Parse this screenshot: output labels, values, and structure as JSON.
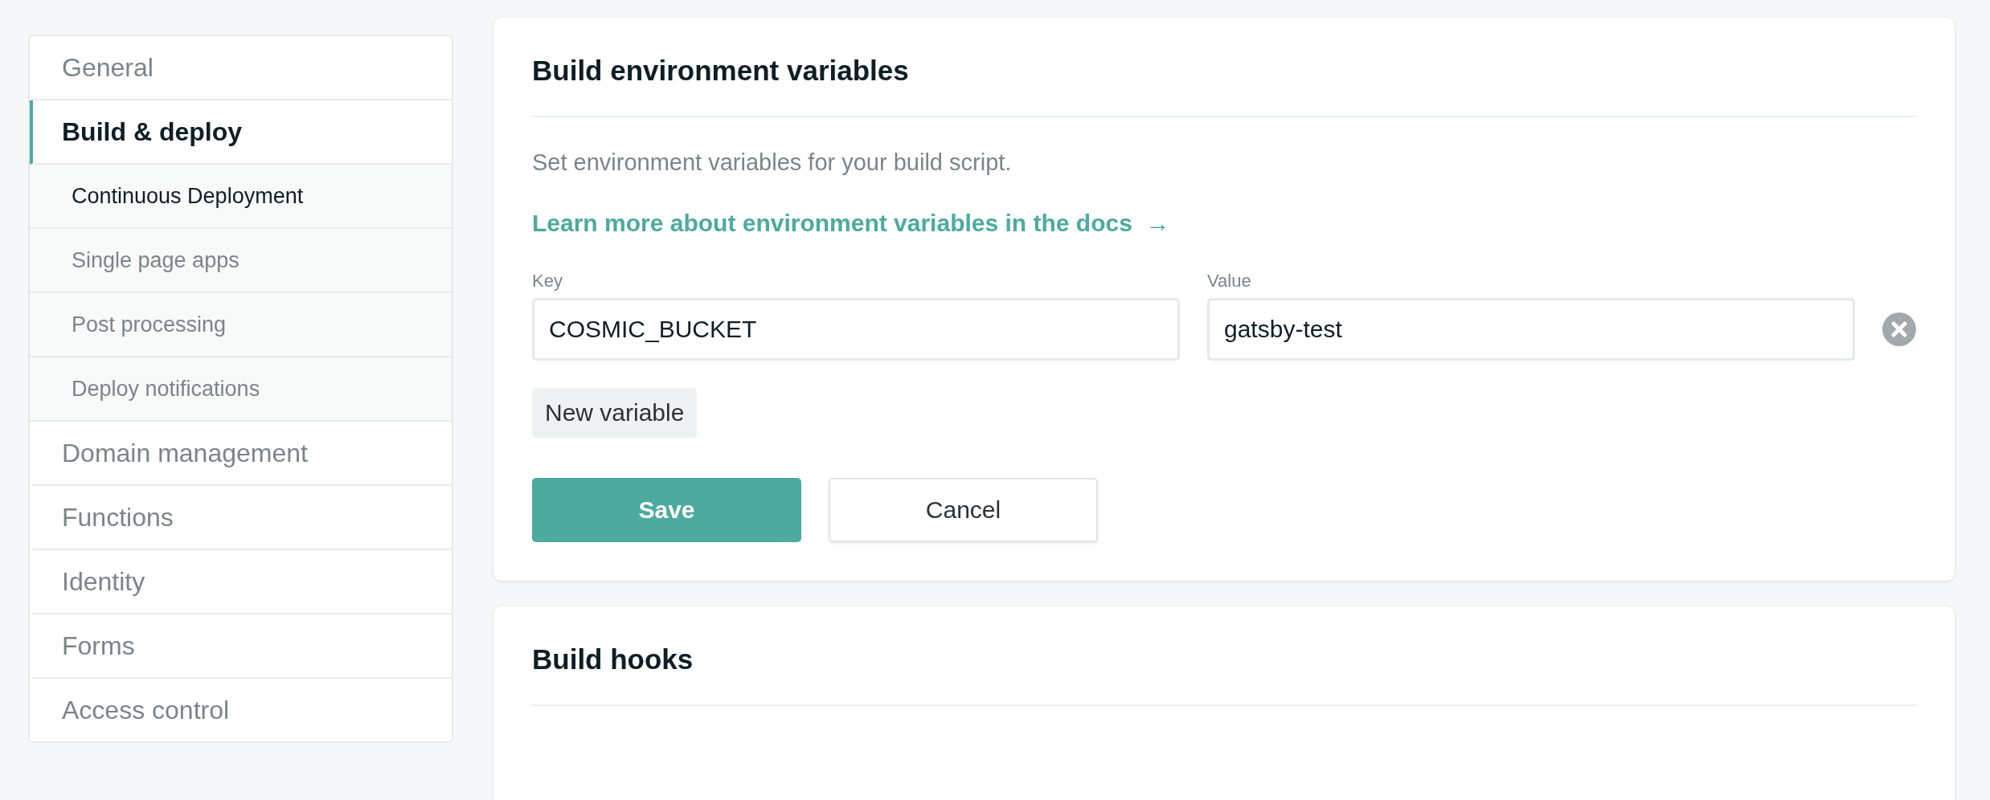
{
  "sidebar": {
    "items": [
      {
        "label": "General",
        "selected": false
      },
      {
        "label": "Build & deploy",
        "selected": true,
        "children": [
          {
            "label": "Continuous Deployment",
            "selected": true
          },
          {
            "label": "Single page apps",
            "selected": false
          },
          {
            "label": "Post processing",
            "selected": false
          },
          {
            "label": "Deploy notifications",
            "selected": false
          }
        ]
      },
      {
        "label": "Domain management",
        "selected": false
      },
      {
        "label": "Functions",
        "selected": false
      },
      {
        "label": "Identity",
        "selected": false
      },
      {
        "label": "Forms",
        "selected": false
      },
      {
        "label": "Access control",
        "selected": false
      }
    ]
  },
  "env_card": {
    "title": "Build environment variables",
    "description": "Set environment variables for your build script.",
    "link": "Learn more about environment variables in the docs",
    "link_arrow": "→",
    "variables": [
      {
        "key_label": "Key",
        "key": "COSMIC_BUCKET",
        "value_label": "Value",
        "value": "gatsby-test"
      }
    ],
    "new_variable_button": "New variable",
    "save_button": "Save",
    "cancel_button": "Cancel"
  },
  "hooks_card": {
    "title": "Build hooks"
  }
}
